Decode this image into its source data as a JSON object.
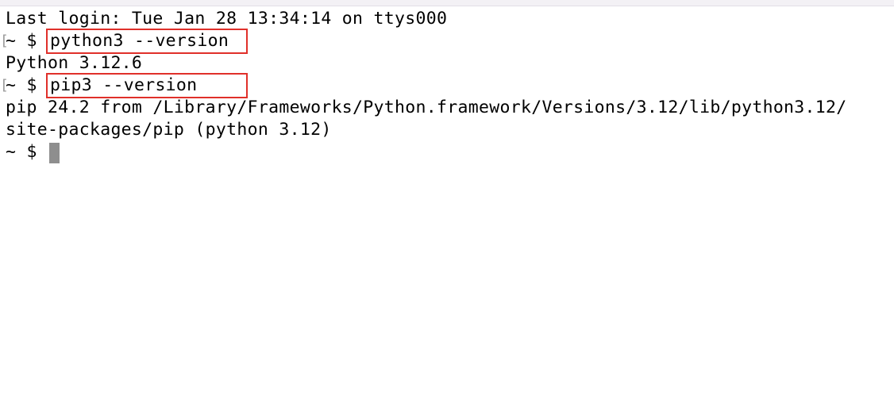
{
  "terminal": {
    "last_login": "Last login: Tue Jan 28 13:34:14 on ttys000",
    "prompt": "~ $ ",
    "prompt_bracket": "[",
    "commands": [
      {
        "input": "python3 --version",
        "output": [
          "Python 3.12.6"
        ]
      },
      {
        "input": "pip3 --version",
        "output": [
          "pip 24.2 from /Library/Frameworks/Python.framework/Versions/3.12/lib/python3.12/",
          "site-packages/pip (python 3.12)"
        ]
      }
    ],
    "highlight_color": "#e0302a",
    "cursor_color": "#8e8e8e"
  }
}
